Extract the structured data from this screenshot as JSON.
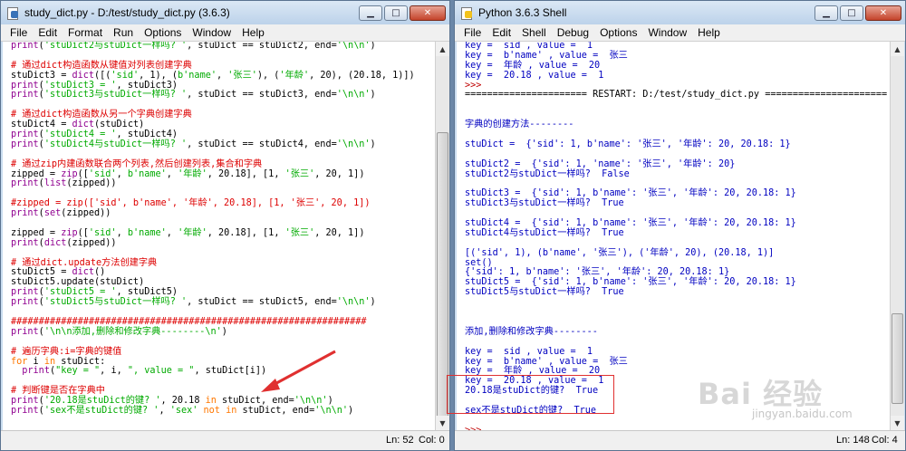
{
  "editor": {
    "title": "study_dict.py - D:/test/study_dict.py (3.6.3)",
    "menus": [
      "File",
      "Edit",
      "Format",
      "Run",
      "Options",
      "Window",
      "Help"
    ],
    "status": {
      "ln": "Ln: 52",
      "col": "Col: 0"
    },
    "lines": [
      [
        [
          "b",
          "print"
        ],
        [
          "x",
          "("
        ],
        [
          "s",
          "'stuDict2与stuDict一样吗? '"
        ],
        [
          "x",
          ", stuDict == stuDict2, end="
        ],
        [
          "s",
          "'\\n\\n'"
        ],
        [
          "x",
          ")"
        ]
      ],
      [
        [
          "x",
          ""
        ]
      ],
      [
        [
          "c",
          "# 通过dict构造函数从键值对列表创建字典"
        ]
      ],
      [
        [
          "x",
          "stuDict3 = "
        ],
        [
          "b",
          "dict"
        ],
        [
          "x",
          "([("
        ],
        [
          "s",
          "'sid'"
        ],
        [
          "x",
          ", 1), ("
        ],
        [
          "s",
          "b'name'"
        ],
        [
          "x",
          ", "
        ],
        [
          "s",
          "'张三'"
        ],
        [
          "x",
          "), ("
        ],
        [
          "s",
          "'年龄'"
        ],
        [
          "x",
          ", 20), (20.18, 1)])"
        ]
      ],
      [
        [
          "b",
          "print"
        ],
        [
          "x",
          "("
        ],
        [
          "s",
          "'stuDict3 = '"
        ],
        [
          "x",
          ", stuDict3)"
        ]
      ],
      [
        [
          "b",
          "print"
        ],
        [
          "x",
          "("
        ],
        [
          "s",
          "'stuDict3与stuDict一样吗? '"
        ],
        [
          "x",
          ", stuDict == stuDict3, end="
        ],
        [
          "s",
          "'\\n\\n'"
        ],
        [
          "x",
          ")"
        ]
      ],
      [
        [
          "x",
          ""
        ]
      ],
      [
        [
          "c",
          "# 通过dict构造函数从另一个字典创建字典"
        ]
      ],
      [
        [
          "x",
          "stuDict4 = "
        ],
        [
          "b",
          "dict"
        ],
        [
          "x",
          "(stuDict)"
        ]
      ],
      [
        [
          "b",
          "print"
        ],
        [
          "x",
          "("
        ],
        [
          "s",
          "'stuDict4 = '"
        ],
        [
          "x",
          ", stuDict4)"
        ]
      ],
      [
        [
          "b",
          "print"
        ],
        [
          "x",
          "("
        ],
        [
          "s",
          "'stuDict4与stuDict一样吗? '"
        ],
        [
          "x",
          ", stuDict == stuDict4, end="
        ],
        [
          "s",
          "'\\n\\n'"
        ],
        [
          "x",
          ")"
        ]
      ],
      [
        [
          "x",
          ""
        ]
      ],
      [
        [
          "c",
          "# 通过zip内建函数联合两个列表,然后创建列表,集合和字典"
        ]
      ],
      [
        [
          "x",
          "zipped = "
        ],
        [
          "b",
          "zip"
        ],
        [
          "x",
          "(["
        ],
        [
          "s",
          "'sid'"
        ],
        [
          "x",
          ", "
        ],
        [
          "s",
          "b'name'"
        ],
        [
          "x",
          ", "
        ],
        [
          "s",
          "'年龄'"
        ],
        [
          "x",
          ", 20.18], [1, "
        ],
        [
          "s",
          "'张三'"
        ],
        [
          "x",
          ", 20, 1])"
        ]
      ],
      [
        [
          "b",
          "print"
        ],
        [
          "x",
          "("
        ],
        [
          "b",
          "list"
        ],
        [
          "x",
          "(zipped))"
        ]
      ],
      [
        [
          "x",
          ""
        ]
      ],
      [
        [
          "c",
          "#zipped = zip(['sid', b'name', '年龄', 20.18], [1, '张三', 20, 1])"
        ]
      ],
      [
        [
          "b",
          "print"
        ],
        [
          "x",
          "("
        ],
        [
          "b",
          "set"
        ],
        [
          "x",
          "(zipped))"
        ]
      ],
      [
        [
          "x",
          ""
        ]
      ],
      [
        [
          "x",
          "zipped = "
        ],
        [
          "b",
          "zip"
        ],
        [
          "x",
          "(["
        ],
        [
          "s",
          "'sid'"
        ],
        [
          "x",
          ", "
        ],
        [
          "s",
          "b'name'"
        ],
        [
          "x",
          ", "
        ],
        [
          "s",
          "'年龄'"
        ],
        [
          "x",
          ", 20.18], [1, "
        ],
        [
          "s",
          "'张三'"
        ],
        [
          "x",
          ", 20, 1])"
        ]
      ],
      [
        [
          "b",
          "print"
        ],
        [
          "x",
          "("
        ],
        [
          "b",
          "dict"
        ],
        [
          "x",
          "(zipped))"
        ]
      ],
      [
        [
          "x",
          ""
        ]
      ],
      [
        [
          "c",
          "# 通过dict.update方法创建字典"
        ]
      ],
      [
        [
          "x",
          "stuDict5 = "
        ],
        [
          "b",
          "dict"
        ],
        [
          "x",
          "()"
        ]
      ],
      [
        [
          "x",
          "stuDict5.update(stuDict)"
        ]
      ],
      [
        [
          "b",
          "print"
        ],
        [
          "x",
          "("
        ],
        [
          "s",
          "'stuDict5 = '"
        ],
        [
          "x",
          ", stuDict5)"
        ]
      ],
      [
        [
          "b",
          "print"
        ],
        [
          "x",
          "("
        ],
        [
          "s",
          "'stuDict5与stuDict一样吗? '"
        ],
        [
          "x",
          ", stuDict == stuDict5, end="
        ],
        [
          "s",
          "'\\n\\n'"
        ],
        [
          "x",
          ")"
        ]
      ],
      [
        [
          "x",
          ""
        ]
      ],
      [
        [
          "c",
          "################################################################"
        ]
      ],
      [
        [
          "b",
          "print"
        ],
        [
          "x",
          "("
        ],
        [
          "s",
          "'\\n\\n添加,删除和修改字典--------\\n'"
        ],
        [
          "x",
          ")"
        ]
      ],
      [
        [
          "x",
          ""
        ]
      ],
      [
        [
          "c",
          "# 遍历字典:i=字典的键值"
        ]
      ],
      [
        [
          "k",
          "for"
        ],
        [
          "x",
          " i "
        ],
        [
          "k",
          "in"
        ],
        [
          "x",
          " stuDict:"
        ]
      ],
      [
        [
          "x",
          "  "
        ],
        [
          "b",
          "print"
        ],
        [
          "x",
          "("
        ],
        [
          "s",
          "\"key = \""
        ],
        [
          "x",
          ", i, "
        ],
        [
          "s",
          "\", value = \""
        ],
        [
          "x",
          ", stuDict[i])"
        ]
      ],
      [
        [
          "x",
          ""
        ]
      ],
      [
        [
          "c",
          "# 判断键是否在字典中"
        ]
      ],
      [
        [
          "b",
          "print"
        ],
        [
          "x",
          "("
        ],
        [
          "s",
          "'20.18是stuDict的键? '"
        ],
        [
          "x",
          ", 20.18 "
        ],
        [
          "k",
          "in"
        ],
        [
          "x",
          " stuDict, end="
        ],
        [
          "s",
          "'\\n\\n'"
        ],
        [
          "x",
          ")"
        ]
      ],
      [
        [
          "b",
          "print"
        ],
        [
          "x",
          "("
        ],
        [
          "s",
          "'sex不是stuDict的键? '"
        ],
        [
          "x",
          ", "
        ],
        [
          "s",
          "'sex'"
        ],
        [
          "x",
          " "
        ],
        [
          "k",
          "not in"
        ],
        [
          "x",
          " stuDict, end="
        ],
        [
          "s",
          "'\\n\\n'"
        ],
        [
          "x",
          ")"
        ]
      ]
    ]
  },
  "shell": {
    "title": "Python 3.6.3 Shell",
    "menus": [
      "File",
      "Edit",
      "Shell",
      "Debug",
      "Options",
      "Window",
      "Help"
    ],
    "status": {
      "ln": "Ln: 148",
      "col": "Col: 4"
    },
    "lines": [
      [
        [
          "o",
          "key =  sid , value =  1"
        ]
      ],
      [
        [
          "o",
          "key =  b'name' , value =  张三"
        ]
      ],
      [
        [
          "o",
          "key =  年龄 , value =  20"
        ]
      ],
      [
        [
          "o",
          "key =  20.18 , value =  1"
        ]
      ],
      [
        [
          "p",
          ">>> "
        ]
      ],
      [
        [
          "x",
          "====================== RESTART: D:/test/study_dict.py ======================"
        ]
      ],
      [
        [
          "x",
          ""
        ]
      ],
      [
        [
          "x",
          ""
        ]
      ],
      [
        [
          "o",
          "字典的创建方法--------"
        ]
      ],
      [
        [
          "x",
          ""
        ]
      ],
      [
        [
          "o",
          "stuDict =  {'sid': 1, b'name': '张三', '年龄': 20, 20.18: 1}"
        ]
      ],
      [
        [
          "x",
          ""
        ]
      ],
      [
        [
          "o",
          "stuDict2 =  {'sid': 1, 'name': '张三', '年龄': 20}"
        ]
      ],
      [
        [
          "o",
          "stuDict2与stuDict一样吗?  False"
        ]
      ],
      [
        [
          "x",
          ""
        ]
      ],
      [
        [
          "o",
          "stuDict3 =  {'sid': 1, b'name': '张三', '年龄': 20, 20.18: 1}"
        ]
      ],
      [
        [
          "o",
          "stuDict3与stuDict一样吗?  True"
        ]
      ],
      [
        [
          "x",
          ""
        ]
      ],
      [
        [
          "o",
          "stuDict4 =  {'sid': 1, b'name': '张三', '年龄': 20, 20.18: 1}"
        ]
      ],
      [
        [
          "o",
          "stuDict4与stuDict一样吗?  True"
        ]
      ],
      [
        [
          "x",
          ""
        ]
      ],
      [
        [
          "o",
          "[('sid', 1), (b'name', '张三'), ('年龄', 20), (20.18, 1)]"
        ]
      ],
      [
        [
          "o",
          "set()"
        ]
      ],
      [
        [
          "o",
          "{'sid': 1, b'name': '张三', '年龄': 20, 20.18: 1}"
        ]
      ],
      [
        [
          "o",
          "stuDict5 =  {'sid': 1, b'name': '张三', '年龄': 20, 20.18: 1}"
        ]
      ],
      [
        [
          "o",
          "stuDict5与stuDict一样吗?  True"
        ]
      ],
      [
        [
          "x",
          ""
        ]
      ],
      [
        [
          "x",
          ""
        ]
      ],
      [
        [
          "x",
          ""
        ]
      ],
      [
        [
          "o",
          "添加,删除和修改字典--------"
        ]
      ],
      [
        [
          "x",
          ""
        ]
      ],
      [
        [
          "o",
          "key =  sid , value =  1"
        ]
      ],
      [
        [
          "o",
          "key =  b'name' , value =  张三"
        ]
      ],
      [
        [
          "o",
          "key =  年龄 , value =  20"
        ]
      ],
      [
        [
          "o",
          "key =  20.18 , value =  1"
        ]
      ],
      [
        [
          "o",
          "20.18是stuDict的键?  True"
        ]
      ],
      [
        [
          "x",
          ""
        ]
      ],
      [
        [
          "o",
          "sex不是stuDict的键?  True"
        ]
      ],
      [
        [
          "x",
          ""
        ]
      ],
      [
        [
          "p",
          ">>> "
        ]
      ]
    ]
  },
  "watermark": {
    "brand": "Bai 经验",
    "url": "jingyan.baidu.com"
  },
  "colors": {
    "keyword": "#ff7700",
    "string": "#00aa00",
    "comment": "#dd0000",
    "builtin": "#900090",
    "output": "#0000c0",
    "prompt": "#c00000",
    "highlight": "#e03030"
  }
}
